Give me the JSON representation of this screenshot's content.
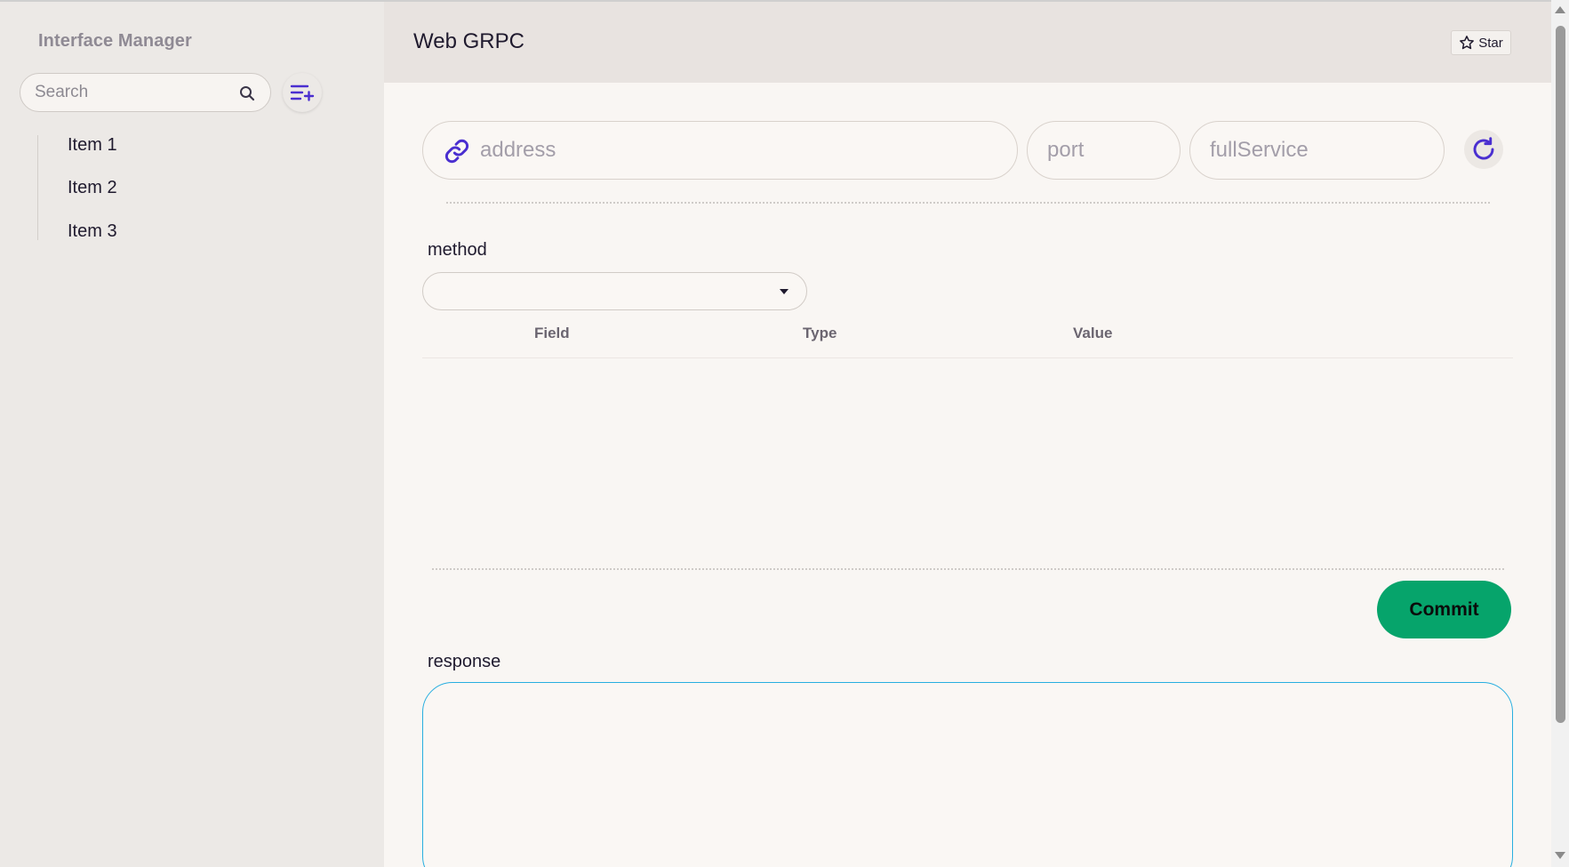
{
  "sidebar": {
    "title": "Interface Manager",
    "search": {
      "placeholder": "Search",
      "value": ""
    },
    "items": [
      {
        "label": "Item 1"
      },
      {
        "label": "Item 2"
      },
      {
        "label": "Item 3"
      }
    ]
  },
  "header": {
    "title": "Web GRPC",
    "star_label": "Star"
  },
  "connection": {
    "address_placeholder": "address",
    "port_placeholder": "port",
    "service_placeholder": "fullService"
  },
  "method": {
    "label": "method",
    "selected": ""
  },
  "table": {
    "columns": [
      "Field",
      "Type",
      "Value"
    ],
    "rows": []
  },
  "actions": {
    "commit_label": "Commit"
  },
  "response": {
    "label": "response",
    "value": ""
  },
  "colors": {
    "accent": "#4a2fd0",
    "commit": "#06a46b",
    "response_border": "#27aee0"
  }
}
